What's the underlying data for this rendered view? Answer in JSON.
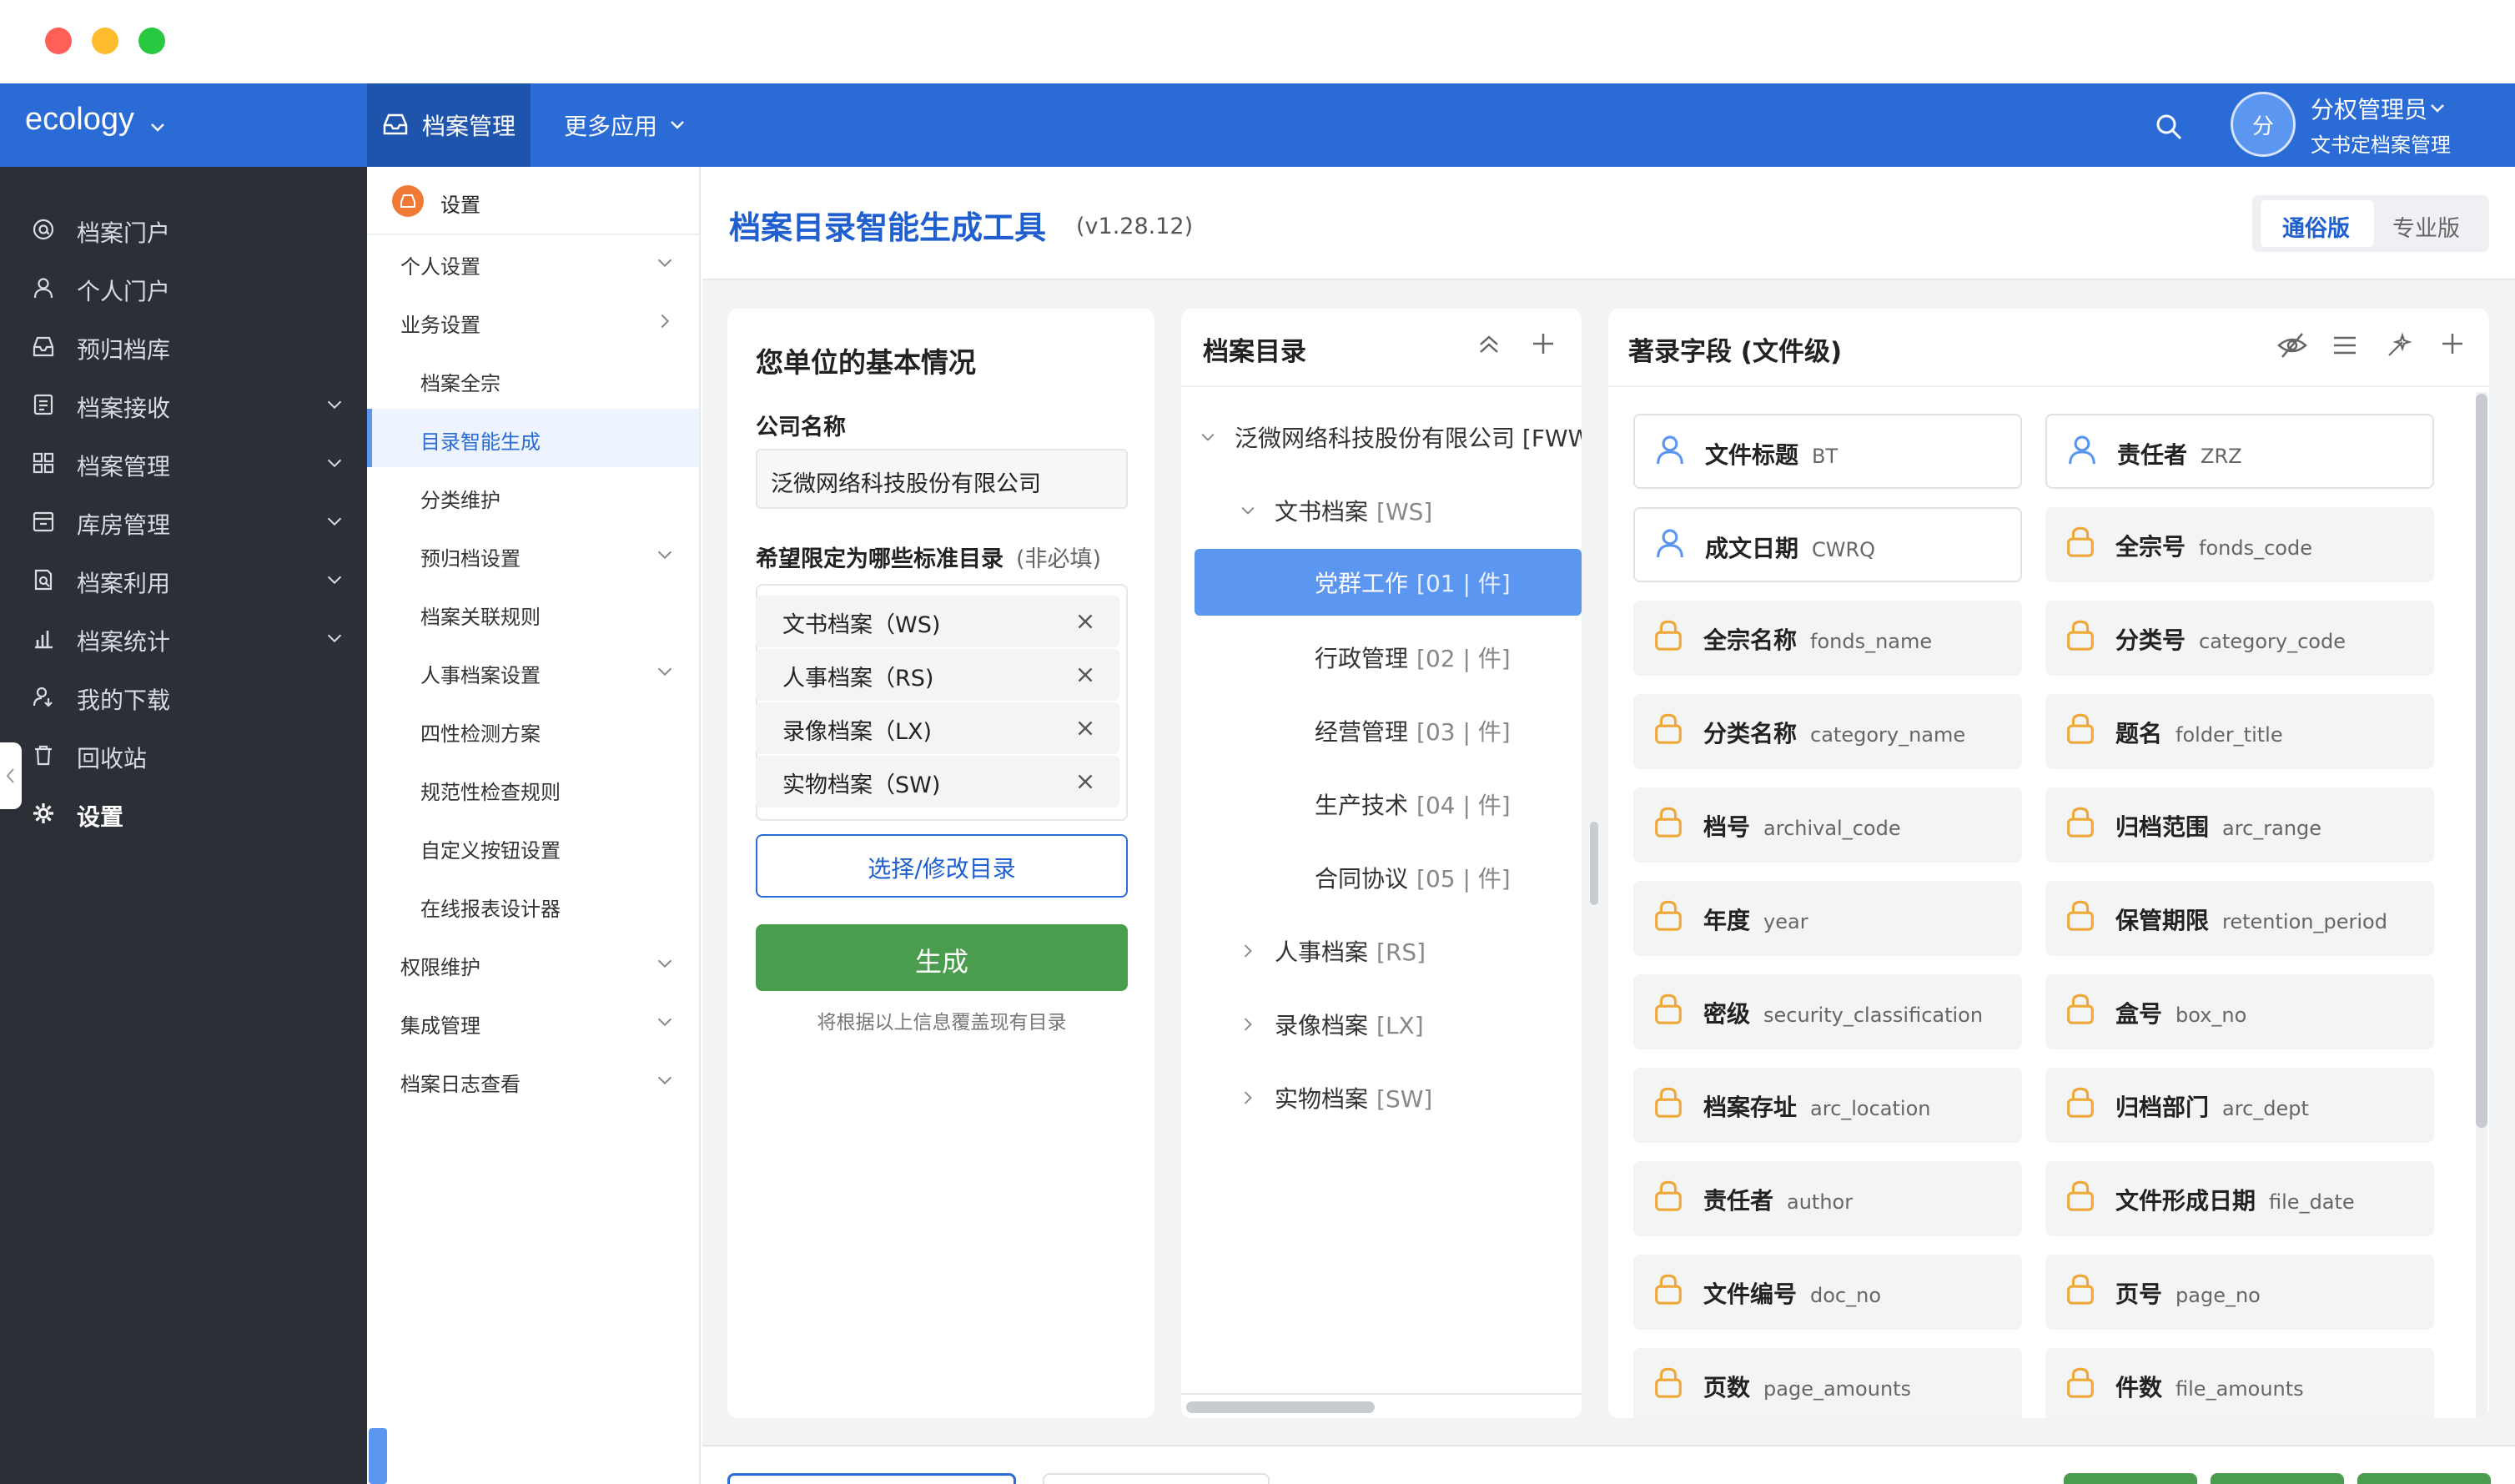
{
  "app": {
    "brand": "ecology",
    "top_tabs": [
      "档案管理",
      "更多应用"
    ],
    "user": {
      "avatar_text": "分",
      "name": "分权管理员",
      "role": "文书定档案管理"
    }
  },
  "left_nav": {
    "items": [
      {
        "label": "档案门户",
        "icon": "at-icon"
      },
      {
        "label": "个人门户",
        "icon": "user-icon"
      },
      {
        "label": "预归档库",
        "icon": "inbox-icon"
      },
      {
        "label": "档案接收",
        "icon": "receive-icon"
      },
      {
        "label": "档案管理",
        "icon": "grid-icon"
      },
      {
        "label": "库房管理",
        "icon": "warehouse-icon"
      },
      {
        "label": "档案利用",
        "icon": "search-doc-icon"
      },
      {
        "label": "档案统计",
        "icon": "bar-chart-icon"
      },
      {
        "label": "我的下载",
        "icon": "download-user-icon"
      },
      {
        "label": "回收站",
        "icon": "trash-icon"
      },
      {
        "label": "设置",
        "icon": "gear-icon"
      }
    ]
  },
  "submenu": {
    "title": "设置",
    "items": [
      {
        "label": "个人设置"
      },
      {
        "label": "业务设置"
      },
      {
        "label": "档案全宗"
      },
      {
        "label": "目录智能生成"
      },
      {
        "label": "分类维护"
      },
      {
        "label": "预归档设置"
      },
      {
        "label": "档案关联规则"
      },
      {
        "label": "人事档案设置"
      },
      {
        "label": "四性检测方案"
      },
      {
        "label": "规范性检查规则"
      },
      {
        "label": "自定义按钮设置"
      },
      {
        "label": "在线报表设计器"
      },
      {
        "label": "权限维护"
      },
      {
        "label": "集成管理"
      },
      {
        "label": "档案日志查看"
      }
    ]
  },
  "header": {
    "title": "档案目录智能生成工具",
    "version": "(v1.28.12)",
    "modes": [
      "通俗版",
      "专业版"
    ]
  },
  "basic_info": {
    "heading": "您单位的基本情况",
    "company_label": "公司名称",
    "company_value": "泛微网络科技股份有限公司",
    "catalog_label": "希望限定为哪些标准目录",
    "catalog_optional": "(非必填)",
    "tags": [
      "文书档案（WS)",
      "人事档案（RS)",
      "录像档案（LX)",
      "实物档案（SW)"
    ],
    "select_button": "选择/修改目录",
    "generate_button": "生成",
    "hint": "将根据以上信息覆盖现有目录"
  },
  "catalog": {
    "heading": "档案目录",
    "root": "泛微网络科技股份有限公司 [FWW",
    "ws": {
      "name": "文书档案",
      "code": "[WS]"
    },
    "ws_children": [
      {
        "name": "党群工作",
        "code": "[01 | 件]"
      },
      {
        "name": "行政管理",
        "code": "[02 | 件]"
      },
      {
        "name": "经营管理",
        "code": "[03 | 件]"
      },
      {
        "name": "生产技术",
        "code": "[04 | 件]"
      },
      {
        "name": "合同协议",
        "code": "[05 | 件]"
      }
    ],
    "others": [
      {
        "name": "人事档案",
        "code": "[RS]"
      },
      {
        "name": "录像档案",
        "code": "[LX]"
      },
      {
        "name": "实物档案",
        "code": "[SW]"
      }
    ]
  },
  "fields": {
    "heading": "著录字段 (文件级)",
    "items": [
      {
        "name": "文件标题",
        "code": "BT",
        "icon": "user-icon"
      },
      {
        "name": "责任者",
        "code": "ZRZ",
        "icon": "user-icon"
      },
      {
        "name": "成文日期",
        "code": "CWRQ",
        "icon": "user-icon"
      },
      {
        "name": "全宗号",
        "code": "fonds_code",
        "icon": "lock-icon"
      },
      {
        "name": "全宗名称",
        "code": "fonds_name",
        "icon": "lock-icon"
      },
      {
        "name": "分类号",
        "code": "category_code",
        "icon": "lock-icon"
      },
      {
        "name": "分类名称",
        "code": "category_name",
        "icon": "lock-icon"
      },
      {
        "name": "题名",
        "code": "folder_title",
        "icon": "lock-icon"
      },
      {
        "name": "档号",
        "code": "archival_code",
        "icon": "lock-icon"
      },
      {
        "name": "归档范围",
        "code": "arc_range",
        "icon": "lock-icon"
      },
      {
        "name": "年度",
        "code": "year",
        "icon": "lock-icon"
      },
      {
        "name": "保管期限",
        "code": "retention_period",
        "icon": "lock-icon"
      },
      {
        "name": "密级",
        "code": "security_classification",
        "icon": "lock-icon"
      },
      {
        "name": "盒号",
        "code": "box_no",
        "icon": "lock-icon"
      },
      {
        "name": "档案存址",
        "code": "arc_location",
        "icon": "lock-icon"
      },
      {
        "name": "归档部门",
        "code": "arc_dept",
        "icon": "lock-icon"
      },
      {
        "name": "责任者",
        "code": "author",
        "icon": "lock-icon"
      },
      {
        "name": "文件形成日期",
        "code": "file_date",
        "icon": "lock-icon"
      },
      {
        "name": "文件编号",
        "code": "doc_no",
        "icon": "lock-icon"
      },
      {
        "name": "页号",
        "code": "page_no",
        "icon": "lock-icon"
      },
      {
        "name": "页数",
        "code": "page_amounts",
        "icon": "lock-icon"
      },
      {
        "name": "件数",
        "code": "file_amounts",
        "icon": "lock-icon"
      }
    ]
  },
  "colors": {
    "primary": "#2a6bd6",
    "sidebar": "#2c3036",
    "green": "#4a9d4f",
    "lock": "#f0a838",
    "selected": "#5b96f0"
  }
}
